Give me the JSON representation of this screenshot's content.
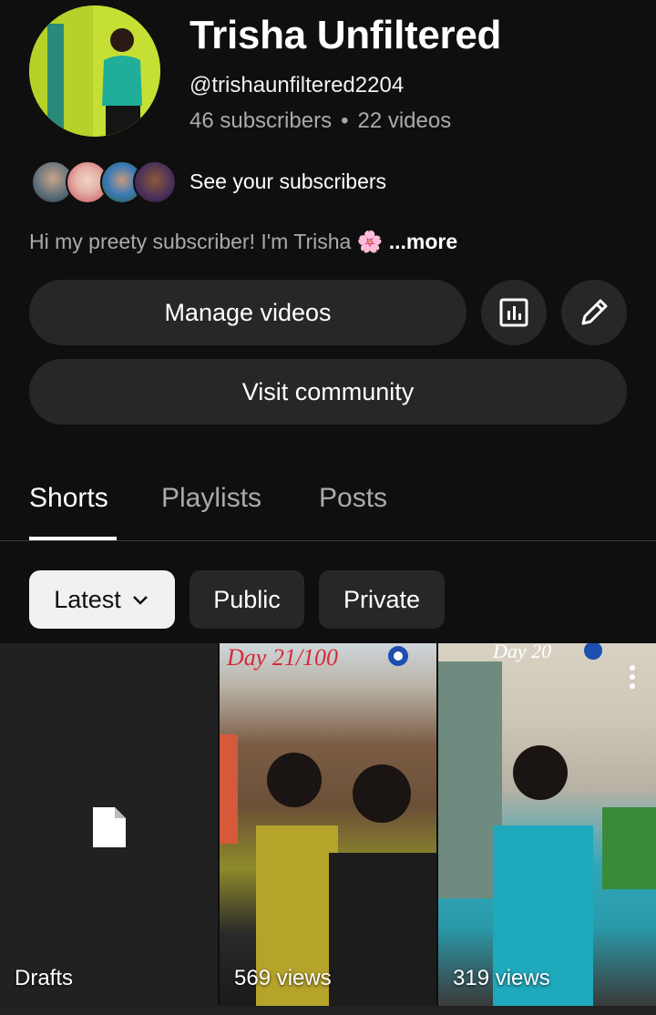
{
  "channel": {
    "name": "Trisha Unfiltered",
    "handle": "@trishaunfiltered2204",
    "subscribers": "46 subscribers",
    "separator": "•",
    "videos": "22 videos",
    "see_subscribers": "See your subscribers",
    "bio": "Hi my preety subscriber! I'm Trisha 🌸",
    "bio_more": "...more"
  },
  "actions": {
    "manage_videos": "Manage videos",
    "visit_community": "Visit community"
  },
  "tabs": [
    {
      "label": "Shorts",
      "active": true
    },
    {
      "label": "Playlists",
      "active": false
    },
    {
      "label": "Posts",
      "active": false
    }
  ],
  "filters": {
    "latest": "Latest",
    "public": "Public",
    "private": "Private"
  },
  "grid": [
    {
      "label": "Drafts"
    },
    {
      "overlay_title": "Day 21/100",
      "views": "569 views"
    },
    {
      "overlay_title": "Day 20",
      "views": "319 views"
    }
  ],
  "icons": {
    "analytics": "bar-chart-icon",
    "edit": "pencil-icon",
    "dropdown": "chevron-down-icon",
    "draft": "document-icon",
    "menu": "more-vert-icon"
  }
}
